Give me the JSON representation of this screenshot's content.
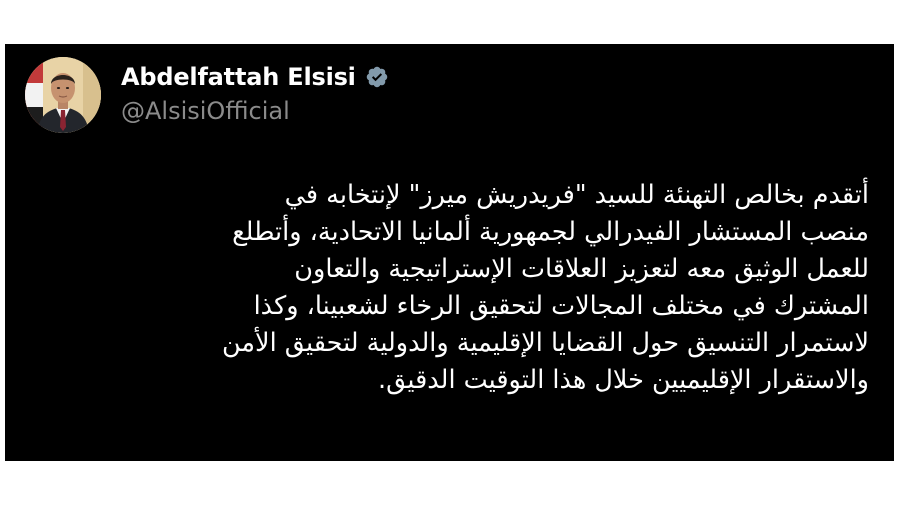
{
  "tweet": {
    "author": {
      "display_name": "Abdelfattah Elsisi",
      "handle": "@AlsisiOfficial",
      "verified": true,
      "verified_badge_color": "#829aab"
    },
    "text_lines": [
      "أتقدم بخالص التهنئة للسيد \"فريدريش ميرز\" لإنتخابه في",
      "منصب المستشار الفيدرالي لجمهورية ألمانيا الاتحادية، وأتطلع",
      "للعمل الوثيق معه لتعزيز العلاقات الإستراتيجية والتعاون",
      "المشترك في مختلف المجالات لتحقيق الرخاء لشعبينا، وكذا",
      "لاستمرار التنسيق حول القضايا الإقليمية والدولية لتحقيق الأمن",
      "والاستقرار الإقليميين خلال هذا التوقيت الدقيق."
    ],
    "colors": {
      "card_background": "#000000",
      "text": "#ffffff",
      "handle": "#8b8b8b"
    }
  }
}
